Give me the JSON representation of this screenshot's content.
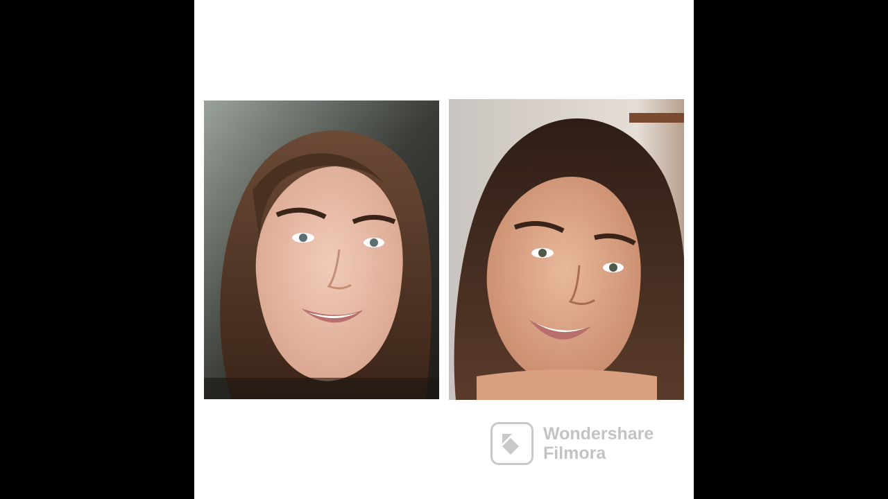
{
  "watermark": {
    "line1": "Wondershare",
    "line2": "Filmora"
  },
  "photos": [
    {
      "subject": "smiling woman with long brown hair"
    },
    {
      "subject": "smiling woman with long dark hair"
    }
  ],
  "colors": {
    "letterbox": "#000000",
    "canvas": "#ffffff",
    "watermark": "#b0b0b0"
  }
}
